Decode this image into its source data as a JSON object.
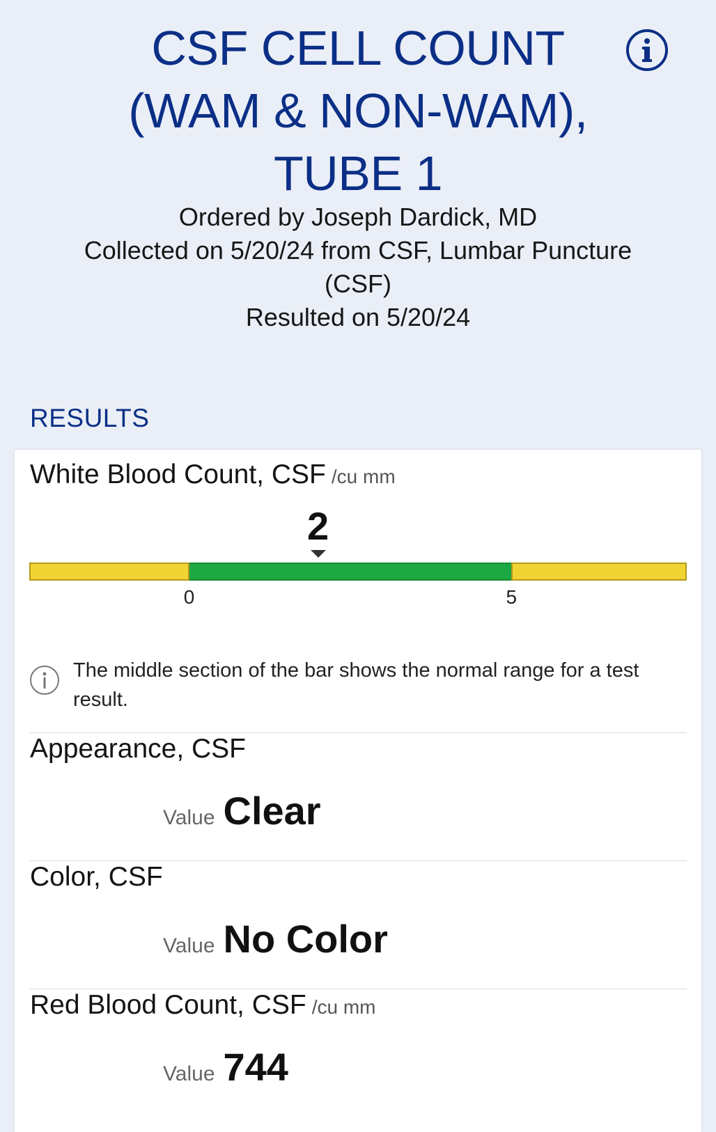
{
  "header": {
    "title_lines": [
      "CSF CELL COUNT",
      "(WAM & NON-WAM),",
      "TUBE 1"
    ],
    "info_icon": "info-circle-icon",
    "ordered_by": "Ordered by Joseph Dardick, MD",
    "collected_line1": "Collected on 5/20/24 from CSF, Lumbar Puncture",
    "collected_line2": "(CSF)",
    "resulted_on": "Resulted on 5/20/24"
  },
  "results": {
    "section_label": "RESULTS",
    "wbc": {
      "name": "White Blood Count, CSF",
      "unit": "/cu mm",
      "value": "2",
      "value_number": 2,
      "range_low": "0",
      "range_high": "5",
      "range_low_number": 0,
      "range_high_number": 5,
      "scale_min": -2.48,
      "scale_max": 7.72,
      "colors": {
        "out_of_range": "#f0d433",
        "normal": "#1ea843"
      },
      "note": "The middle section of the bar shows the normal range for a test result.",
      "note_icon": "info-circle-icon"
    },
    "appearance": {
      "name": "Appearance, CSF",
      "value_label": "Value",
      "value": "Clear"
    },
    "color": {
      "name": "Color, CSF",
      "value_label": "Value",
      "value": "No Color"
    },
    "rbc": {
      "name": "Red Blood Count, CSF",
      "unit": "/cu mm",
      "value_label": "Value",
      "value": "744"
    }
  },
  "colors": {
    "background": "#eaeef7",
    "accent": "#0b2f86"
  }
}
